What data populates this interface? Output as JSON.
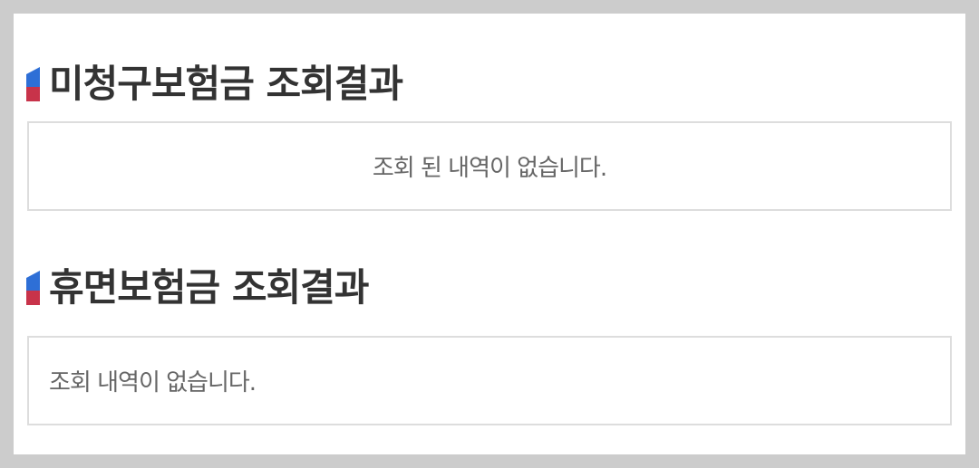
{
  "sections": [
    {
      "title": "미청구보험금 조회결과",
      "message": "조회 된 내역이 없습니다."
    },
    {
      "title": "휴면보험금 조회결과",
      "message": "조회 내역이 없습니다."
    }
  ],
  "colors": {
    "marker_top": "#2e6fd6",
    "marker_bottom": "#c8334a",
    "title_text": "#333333",
    "message_text": "#666666",
    "box_border": "#dddddd",
    "outer_background": "#cccccc"
  }
}
